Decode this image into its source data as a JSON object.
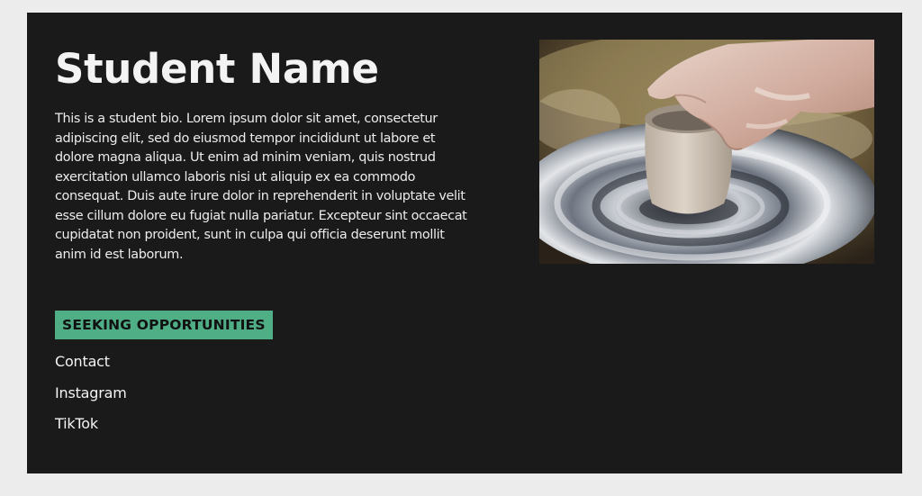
{
  "profile": {
    "name": "Student Name",
    "bio": "This is a student bio. Lorem ipsum dolor sit amet, consectetur adipiscing elit, sed do eiusmod tempor incididunt ut labore et dolore magna aliqua. Ut enim ad minim veniam, quis nostrud exercitation ullamco laboris nisi ut aliquip ex ea commodo consequat. Duis aute irure dolor in reprehenderit in voluptate velit esse cillum dolore eu fugiat nulla pariatur. Excepteur sint occaecat cupidatat non proident, sunt in culpa qui officia deserunt mollit anim id est laborum.",
    "badge": "SEEKING OPPORTUNITIES"
  },
  "links": {
    "contact": "Contact",
    "instagram": "Instagram",
    "tiktok": "TikTok"
  },
  "colors": {
    "card_background": "#1a1a1b",
    "page_background": "#ececec",
    "badge_background": "#4fae86",
    "text": "#f3f3f3"
  },
  "image": {
    "subject": "hands shaping clay on a spinning pottery wheel"
  }
}
